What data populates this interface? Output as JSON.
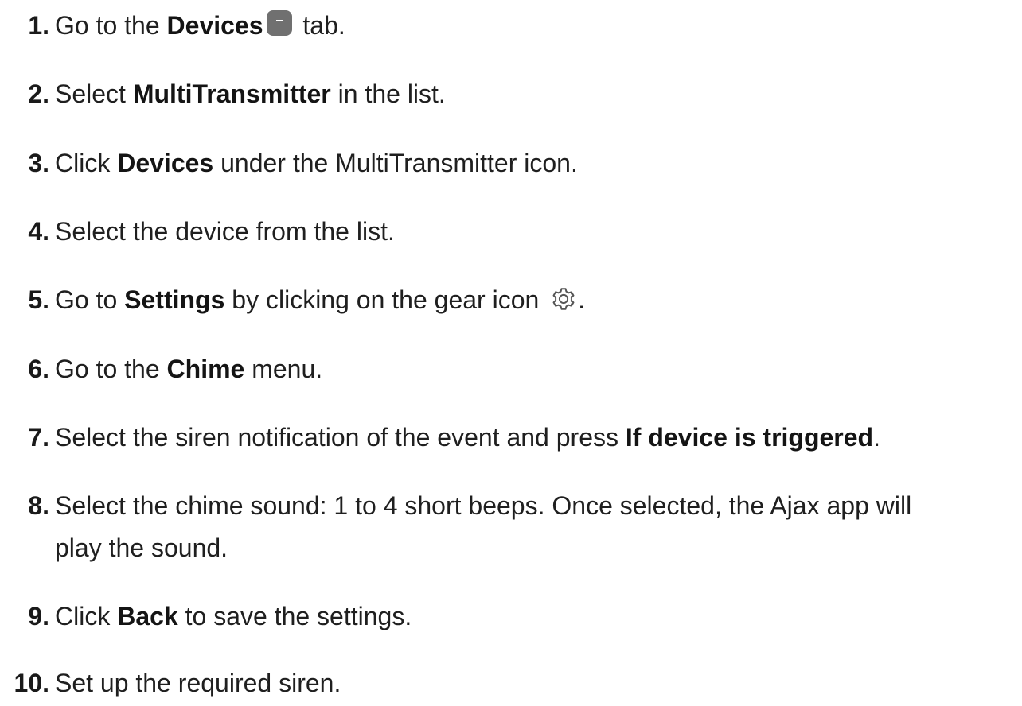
{
  "steps": [
    {
      "num": "1.",
      "p1": "Go to the ",
      "b1": "Devices",
      "p2": " tab."
    },
    {
      "num": "2.",
      "p1": "Select ",
      "b1": "MultiTransmitter",
      "p2": " in the list."
    },
    {
      "num": "3.",
      "p1": "Click ",
      "b1": "Devices",
      "p2": " under the MultiTransmitter icon."
    },
    {
      "num": "4.",
      "p1": "Select the device from the list."
    },
    {
      "num": "5.",
      "p1": "Go to ",
      "b1": "Settings",
      "p2": " by clicking on the gear icon ",
      "p3": "."
    },
    {
      "num": "6.",
      "p1": "Go to the ",
      "b1": "Chime",
      "p2": " menu."
    },
    {
      "num": "7.",
      "p1": "Select the siren notification of the event and press ",
      "b1": "If device is triggered",
      "p2": "."
    },
    {
      "num": "8.",
      "line1": "Select the chime sound: 1 to 4 short beeps. Once selected, the Ajax app will",
      "line2": "play the sound."
    },
    {
      "num": "9.",
      "p1": "Click ",
      "b1": "Back",
      "p2": " to save the settings."
    },
    {
      "num": "10.",
      "p1": "Set up the required siren."
    }
  ],
  "icons": {
    "devices_tab": "devices-tab-icon",
    "gear": "gear-icon"
  }
}
